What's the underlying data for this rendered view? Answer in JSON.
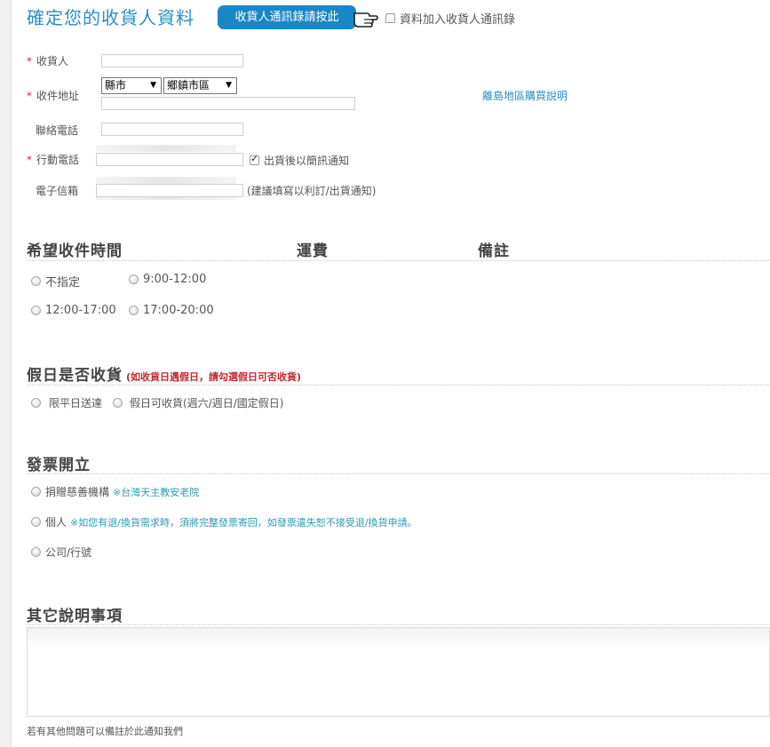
{
  "header": {
    "title": "確定您的收貨人資料",
    "address_book_button": "收貨人通訊錄請按此",
    "add_to_book_label": "資料加入收貨人通訊錄"
  },
  "form": {
    "receiver": {
      "required_mark": "*",
      "label": "收貨人",
      "value": ""
    },
    "address": {
      "required_mark": "*",
      "label": "收件地址",
      "county_selected": "縣市",
      "district_selected": "鄉鎮市區",
      "street_value": "",
      "island_link": "離島地區購買說明"
    },
    "phone": {
      "label": "聯絡電話",
      "value": ""
    },
    "mobile": {
      "required_mark": "*",
      "label": "行動電話",
      "value": "",
      "sms_label": "出貨後以簡訊通知",
      "sms_checked": true
    },
    "email": {
      "label": "電子信箱",
      "value": "",
      "hint": "(建議填寫以利訂/出貨通知)"
    }
  },
  "delivery": {
    "heading": "希望收件時間",
    "shipping_heading": "運費",
    "note_heading": "備註",
    "options": [
      "不指定",
      "9:00-12:00",
      "12:00-17:00",
      "17:00-20:00"
    ]
  },
  "holiday": {
    "heading": "假日是否收貨",
    "note": "(如收貨日遇假日，請勾選假日可否收貨)",
    "options": [
      "限平日送達",
      "假日可收貨(週六/週日/國定假日)"
    ]
  },
  "invoice": {
    "heading": "發票開立",
    "donate_label": "捐贈慈善機構",
    "donate_org": "※台灣天主教安老院",
    "personal_label": "個人",
    "personal_note": "※如您有退/換貨需求時，須將完整發票寄回，如發票遺失恕不接受退/換貨申請。",
    "company_label": "公司/行號"
  },
  "other": {
    "heading": "其它說明事項",
    "textarea_value": "",
    "footnote": "若有其他問題可以備註於此通知我們"
  },
  "colors": {
    "accent": "#1a87c4",
    "title": "#2a8fc0",
    "required": "#cc3333",
    "warning": "#c0282d",
    "info": "#2a9bb0"
  }
}
